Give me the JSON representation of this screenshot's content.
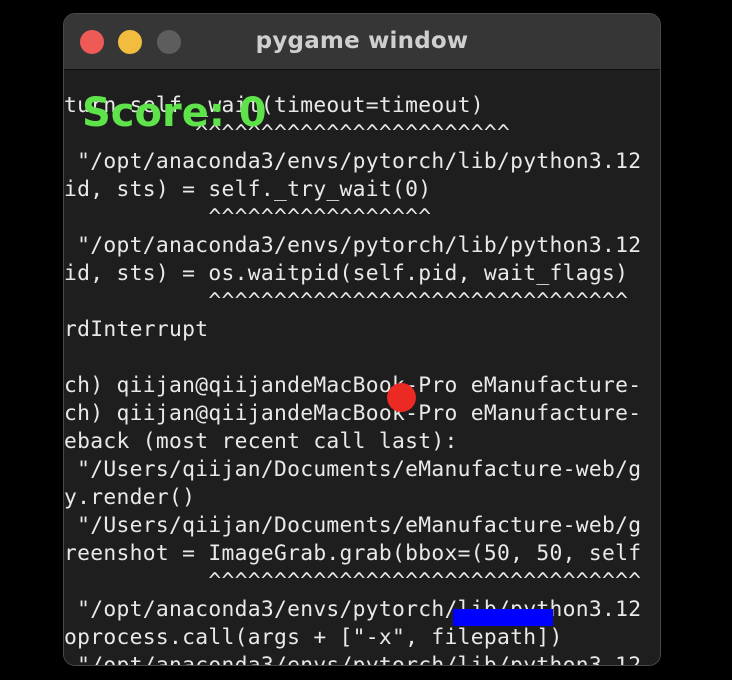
{
  "window": {
    "title": "pygame window"
  },
  "game": {
    "score_text": "Score: 0",
    "ball_color": "#ea2a23",
    "paddle_color": "#0000ff",
    "score_color": "#5ee34a"
  },
  "terminal": {
    "lines": [
      "turn self._wait(timeout=timeout)",
      "          ^^^^^^^^^^^^^^^^^^^^^^^^",
      " \"/opt/anaconda3/envs/pytorch/lib/python3.12",
      "id, sts) = self._try_wait(0)",
      "           ^^^^^^^^^^^^^^^^^",
      " \"/opt/anaconda3/envs/pytorch/lib/python3.12",
      "id, sts) = os.waitpid(self.pid, wait_flags)",
      "           ^^^^^^^^^^^^^^^^^^^^^^^^^^^^^^^^",
      "rdInterrupt",
      "",
      "ch) qiijan@qiijandeMacBook-Pro eManufacture-",
      "ch) qiijan@qiijandeMacBook-Pro eManufacture-",
      "eback (most recent call last):",
      " \"/Users/qiijan/Documents/eManufacture-web/g",
      "y.render()",
      " \"/Users/qiijan/Documents/eManufacture-web/g",
      "reenshot = ImageGrab.grab(bbox=(50, 50, self",
      "           ^^^^^^^^^^^^^^^^^^^^^^^^^^^^^^^^^",
      " \"/opt/anaconda3/envs/pytorch/lib/python3.12",
      "oprocess.call(args + [\"-x\", filepath])",
      " \"/opt/anaconda3/envs/pytorch/lib/python3.12"
    ]
  }
}
